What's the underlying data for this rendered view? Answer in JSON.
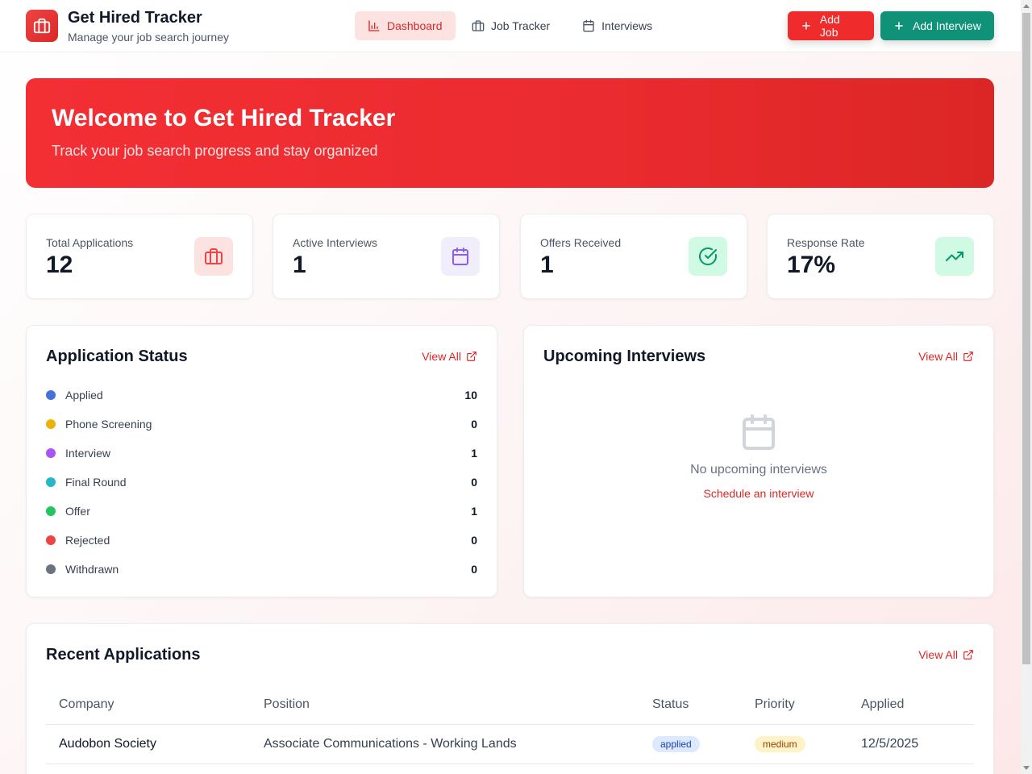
{
  "app": {
    "title": "Get Hired Tracker",
    "subtitle": "Manage your job search journey"
  },
  "nav": {
    "items": [
      {
        "label": "Dashboard",
        "icon": "bar-chart-icon",
        "active": true
      },
      {
        "label": "Job Tracker",
        "icon": "briefcase-icon",
        "active": false
      },
      {
        "label": "Interviews",
        "icon": "calendar-icon",
        "active": false
      }
    ]
  },
  "actions": {
    "add_job": "Add Job",
    "add_interview": "Add Interview"
  },
  "hero": {
    "title": "Welcome to Get Hired Tracker",
    "subtitle": "Track your job search progress and stay organized"
  },
  "stats": [
    {
      "label": "Total Applications",
      "value": "12",
      "icon": "briefcase-icon",
      "color": "#ef4444"
    },
    {
      "label": "Active Interviews",
      "value": "1",
      "icon": "calendar-icon",
      "color": "#8b5cf6"
    },
    {
      "label": "Offers Received",
      "value": "1",
      "icon": "check-circle-icon",
      "color": "#059669"
    },
    {
      "label": "Response Rate",
      "value": "17%",
      "icon": "trending-up-icon",
      "color": "#059669"
    }
  ],
  "application_status": {
    "title": "Application Status",
    "view_all": "View All",
    "rows": [
      {
        "name": "Applied",
        "count": "10",
        "color": "#4472d9"
      },
      {
        "name": "Phone Screening",
        "count": "0",
        "color": "#eab308"
      },
      {
        "name": "Interview",
        "count": "1",
        "color": "#a855f7"
      },
      {
        "name": "Final Round",
        "count": "0",
        "color": "#22b8c6"
      },
      {
        "name": "Offer",
        "count": "1",
        "color": "#22c55e"
      },
      {
        "name": "Rejected",
        "count": "0",
        "color": "#ef4444"
      },
      {
        "name": "Withdrawn",
        "count": "0",
        "color": "#6b7280"
      }
    ]
  },
  "upcoming_interviews": {
    "title": "Upcoming Interviews",
    "view_all": "View All",
    "empty_text": "No upcoming interviews",
    "empty_link": "Schedule an interview"
  },
  "recent_applications": {
    "title": "Recent Applications",
    "view_all": "View All",
    "columns": [
      "Company",
      "Position",
      "Status",
      "Priority",
      "Applied"
    ],
    "rows": [
      {
        "company": "Audobon Society",
        "position": "Associate Communications - Working Lands",
        "status": "applied",
        "priority": "medium",
        "applied": "12/5/2025"
      }
    ]
  }
}
